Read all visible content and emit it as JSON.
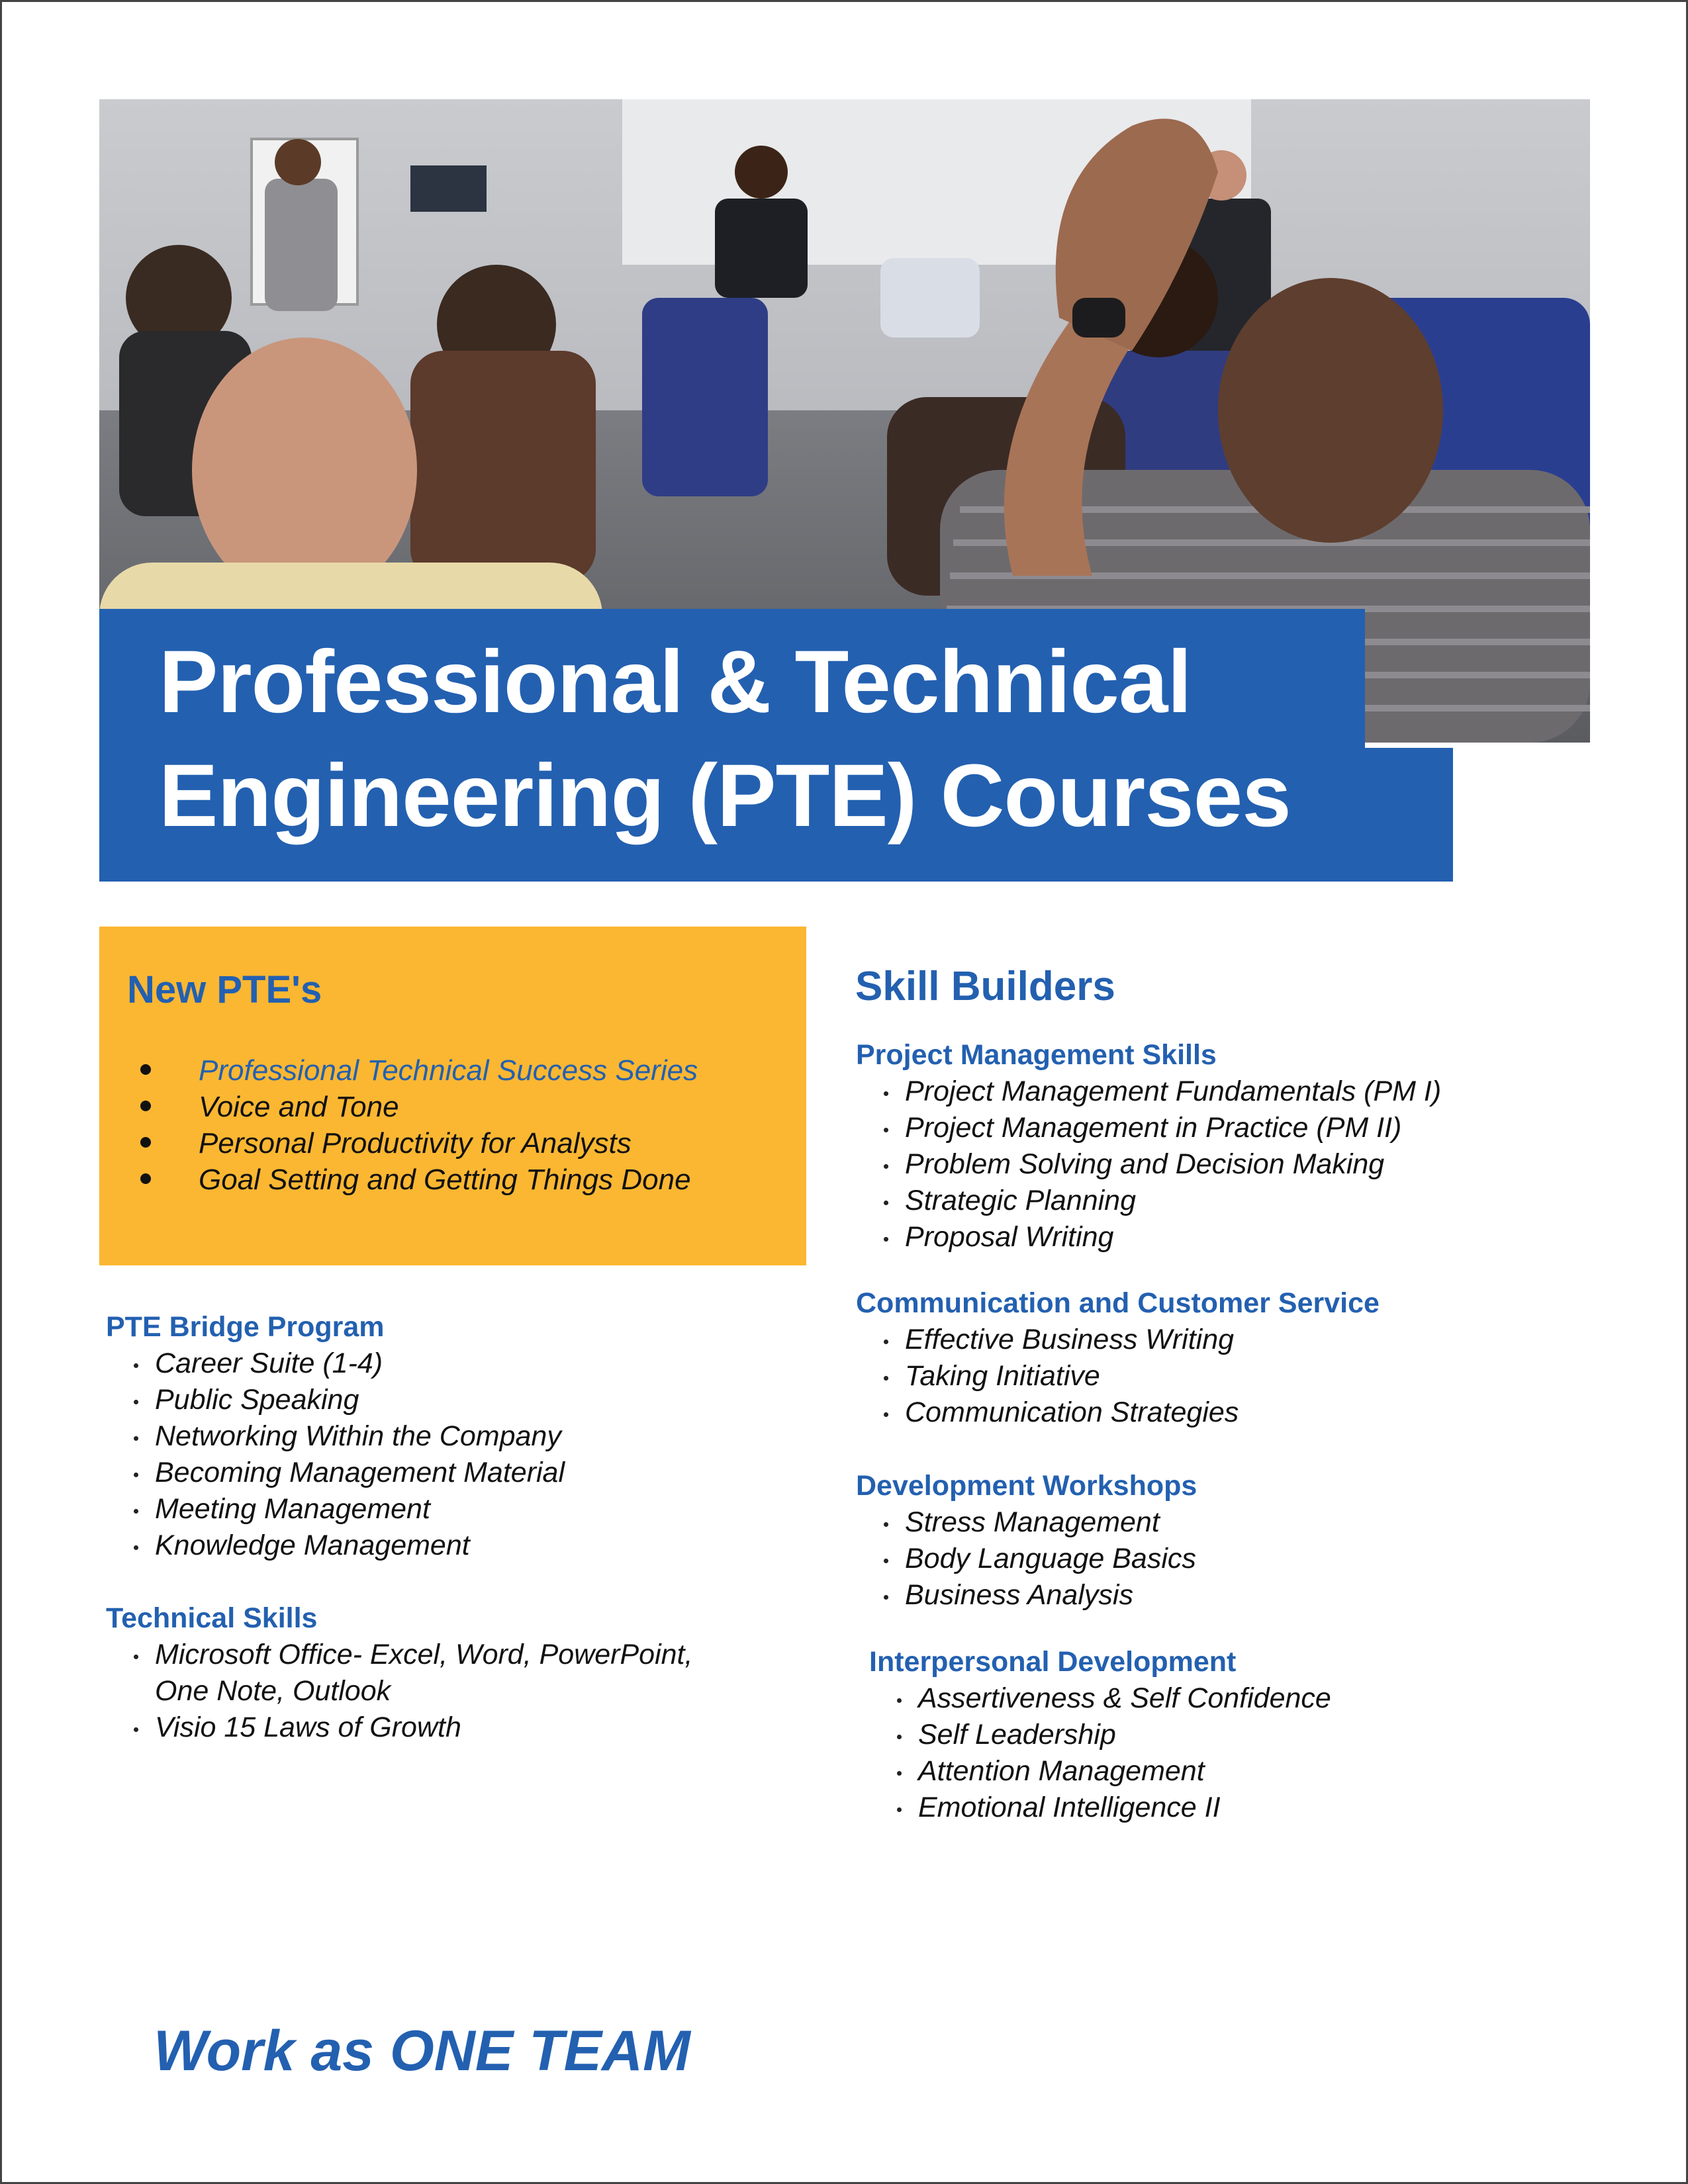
{
  "title": {
    "line1": "Professional & Technical",
    "line2": "Engineering (PTE) Courses"
  },
  "colors": {
    "brand_blue": "#2360b0",
    "accent_yellow": "#fbb732",
    "text": "#111111"
  },
  "new_ptes": {
    "heading": "New PTE's",
    "items": [
      "Professional Technical Success Series",
      "Voice and Tone",
      "Personal Productivity for Analysts",
      "Goal Setting and Getting Things Done"
    ]
  },
  "left_sections": [
    {
      "heading": "PTE Bridge Program",
      "items": [
        "Career Suite (1-4)",
        "Public Speaking",
        "Networking Within the Company",
        "Becoming Management Material",
        "Meeting Management",
        "Knowledge Management"
      ]
    },
    {
      "heading": "Technical Skills",
      "items": [
        "Microsoft Office- Excel, Word, PowerPoint,",
        "Visio 15 Laws of Growth"
      ],
      "continuation": "One Note, Outlook"
    }
  ],
  "skill_builders": {
    "heading": "Skill Builders",
    "sections": [
      {
        "heading": "Project Management Skills",
        "items": [
          "Project Management Fundamentals (PM I)",
          "Project Management in Practice (PM II)",
          "Problem Solving and Decision Making",
          "Strategic Planning",
          "Proposal Writing"
        ]
      },
      {
        "heading": "Communication and Customer Service",
        "items": [
          "Effective Business Writing",
          "Taking Initiative",
          "Communication Strategies"
        ]
      },
      {
        "heading": "Development Workshops",
        "items": [
          "Stress Management",
          "Body Language Basics",
          "Business Analysis"
        ]
      },
      {
        "heading": "Interpersonal Development",
        "items": [
          "Assertiveness & Self Confidence",
          "Self Leadership",
          "Attention Management",
          "Emotional Intelligence II"
        ]
      }
    ]
  },
  "footer": {
    "tagline": "Work as ONE TEAM"
  }
}
